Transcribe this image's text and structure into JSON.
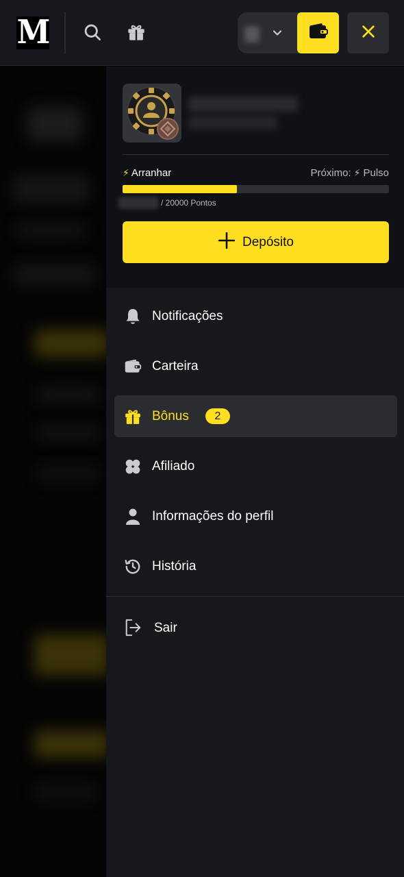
{
  "header": {
    "logo_text": "M",
    "icons": [
      "search-icon",
      "gift-icon",
      "chevron-down-icon",
      "wallet-icon",
      "close-icon"
    ]
  },
  "profile": {
    "level": {
      "current": "Arranhar",
      "next_prefix": "Próximo:",
      "next": "Pulso",
      "progress": 0.43
    },
    "points_suffix": "/ 20000 Pontos",
    "deposit_label": "Depósito"
  },
  "menu": {
    "items": [
      {
        "label": "Notificações",
        "icon": "bell-icon"
      },
      {
        "label": "Carteira",
        "icon": "wallet-icon"
      },
      {
        "label": "Bônus",
        "icon": "gift-icon",
        "badge": "2",
        "active": true
      },
      {
        "label": "Afiliado",
        "icon": "clover-icon"
      },
      {
        "label": "Informações do perfil",
        "icon": "user-icon"
      },
      {
        "label": "História",
        "icon": "history-icon"
      }
    ],
    "logout_label": "Sair"
  },
  "colors": {
    "accent": "#ffdf20",
    "drawer_bg": "#17181b",
    "card_bg": "#101114",
    "active_bg": "#2a2c30"
  }
}
